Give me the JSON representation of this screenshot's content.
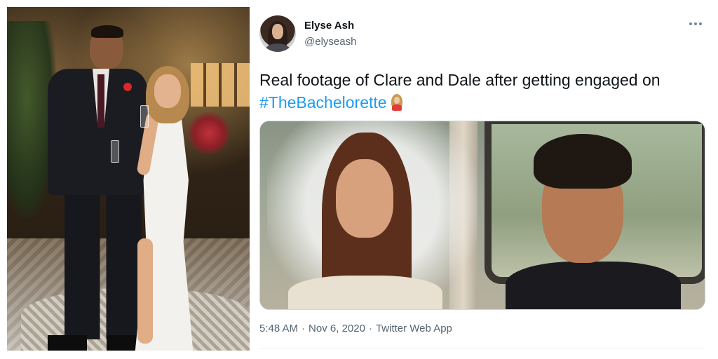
{
  "tweet": {
    "display_name": "Elyse Ash",
    "handle": "@elyseash",
    "text_before": "Real footage of Clare and Dale after getting engaged on ",
    "hashtag": "#TheBachelorette",
    "emoji": "bride-emoji",
    "time": "5:48 AM",
    "date": "Nov 6, 2020",
    "source": "Twitter Web App",
    "separator": "·"
  },
  "icons": {
    "more": "more-options-icon",
    "avatar": "profile-avatar"
  },
  "colors": {
    "link": "#1d9bf0",
    "secondary_text": "#536471",
    "primary_text": "#0f1419"
  }
}
